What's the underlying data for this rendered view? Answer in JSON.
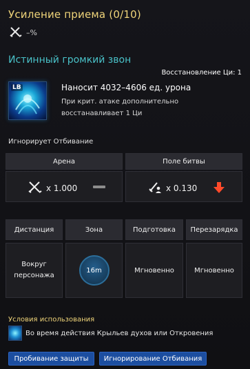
{
  "header": {
    "title": "Усиление приема (0/10)",
    "bonus_value": "–%"
  },
  "skill": {
    "name": "Истинный громкий звон",
    "cooldown": "Восстановление Ци: 1",
    "icon_badge": "LB",
    "damage": "Наносит 4032–4606 ед. урона",
    "crit_line1": "При крит. атаке дополнительно",
    "crit_line2": "восстанавливает 1 Ци",
    "ignore": "Игнорирует Отбивание"
  },
  "modes": {
    "arena": {
      "label": "Арена",
      "value": "x 1.000"
    },
    "field": {
      "label": "Поле битвы",
      "value": "x 0.130"
    }
  },
  "stats": {
    "range": {
      "label": "Дистанция",
      "value": "Вокруг персонажа"
    },
    "zone": {
      "label": "Зона",
      "value": "16m"
    },
    "cast": {
      "label": "Подготовка",
      "value": "Мгновенно"
    },
    "recharge": {
      "label": "Перезарядка",
      "value": "Мгновенно"
    }
  },
  "conditions": {
    "title": "Условия использования",
    "text": "Во время действия Крыльев духов или Откровения"
  },
  "tags": [
    "Пробивание защиты",
    "Игнорирование Отбивания"
  ],
  "colors": {
    "title": "#f0d57a",
    "skill_name": "#49c1c8",
    "tag": "#1c4ea0",
    "down_arrow": "#ff4a2a"
  }
}
